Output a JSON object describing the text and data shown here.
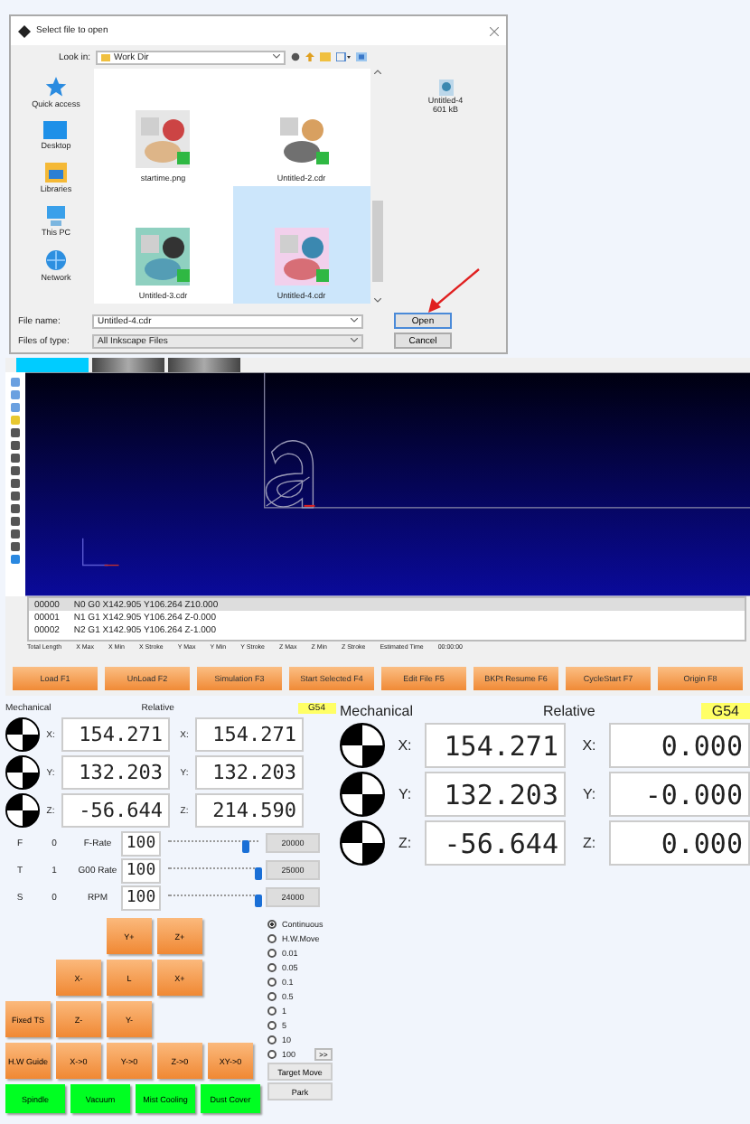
{
  "file_dialog": {
    "title": "Select file to open",
    "look_in_label": "Look in:",
    "look_in": "Work Dir",
    "places": [
      {
        "label": "Quick access",
        "kind": "star"
      },
      {
        "label": "Desktop",
        "kind": "desktop"
      },
      {
        "label": "Libraries",
        "kind": "library"
      },
      {
        "label": "This PC",
        "kind": "pc"
      },
      {
        "label": "Network",
        "kind": "network"
      }
    ],
    "files": [
      {
        "name": "startime.png",
        "selected": false
      },
      {
        "name": "Untitled-2.cdr",
        "selected": false
      },
      {
        "name": "Untitled-3.cdr",
        "selected": false
      },
      {
        "name": "Untitled-4.cdr",
        "selected": true
      }
    ],
    "preview": {
      "name": "Untitled-4",
      "size": "601 kB"
    },
    "file_name_label": "File name:",
    "file_name": "Untitled-4.cdr",
    "file_type_label": "Files of type:",
    "file_type": "All Inkscape Files",
    "buttons": [
      "Open",
      "Cancel"
    ]
  },
  "cnc": {
    "tabs": [
      {
        "selected": true
      },
      {
        "selected": false
      },
      {
        "selected": false
      }
    ],
    "gcode": [
      {
        "line": "00000",
        "code": "N0 G0 X142.905 Y106.264 Z10.000",
        "selected": true
      },
      {
        "line": "00001",
        "code": "N1 G1 X142.905 Y106.264 Z-0.000",
        "selected": false
      },
      {
        "line": "00002",
        "code": "N2 G1 X142.905 Y106.264 Z-1.000",
        "selected": false
      }
    ],
    "stats": [
      "Total Length",
      "X Max",
      "X Min",
      "X Stroke",
      "Y Max",
      "Y Min",
      "Y Stroke",
      "Z Max",
      "Z Min",
      "Z Stroke"
    ],
    "estimated_time_label": "Estimated Time",
    "estimated_time": "00:00:00",
    "buttons": [
      "Load F1",
      "UnLoad F2",
      "Simulation F3",
      "Start Selected F4",
      "Edit File F5",
      "BKPt Resume F6",
      "CycleStart F7",
      "Origin F8"
    ]
  },
  "control_panel": {
    "mechanical_label": "Mechanical",
    "relative_label": "Relative",
    "work_offset": "G54",
    "mechanical": [
      {
        "axis": "X:",
        "value": "154.271"
      },
      {
        "axis": "Y:",
        "value": "132.203"
      },
      {
        "axis": "Z:",
        "value": "-56.644"
      }
    ],
    "relative": [
      {
        "axis": "X:",
        "value": "154.271"
      },
      {
        "axis": "Y:",
        "value": "132.203"
      },
      {
        "axis": "Z:",
        "value": "214.590"
      }
    ],
    "overrides": [
      {
        "letter": "F",
        "value": "0",
        "label": "F-Rate",
        "percent": "100",
        "level": 0.85,
        "max": "20000"
      },
      {
        "letter": "T",
        "value": "1",
        "label": "G00 Rate",
        "percent": "100",
        "level": 1,
        "max": "25000"
      },
      {
        "letter": "S",
        "value": "0",
        "label": "RPM",
        "percent": "100",
        "level": 1,
        "max": "24000"
      }
    ],
    "step_modes": [
      {
        "label": "Continuous",
        "selected": true
      },
      {
        "label": "H.W.Move",
        "selected": false
      },
      {
        "label": "0.01",
        "selected": false
      },
      {
        "label": "0.05",
        "selected": false
      },
      {
        "label": "0.1",
        "selected": false
      },
      {
        "label": "0.5",
        "selected": false
      },
      {
        "label": "1",
        "selected": false
      },
      {
        "label": "5",
        "selected": false
      },
      {
        "label": "10",
        "selected": false
      },
      {
        "label": "100",
        "selected": false
      }
    ],
    "more_button": ">>",
    "target_move": "Target Move",
    "park": "Park",
    "jog_buttons": [
      "Y+",
      "Z+",
      "X-",
      "L",
      "X+",
      "Fixed TS",
      "Z-",
      "Y-",
      "H.W Guide",
      "X->0",
      "Y->0",
      "Z->0",
      "XY->0"
    ],
    "toggles": [
      "Spindle",
      "Vacuum",
      "Mist Cooling",
      "Dust Cover"
    ]
  },
  "zoomed_panel": {
    "mechanical_label": "Mechanical",
    "relative_label": "Relative",
    "work_offset": "G54",
    "mechanical": [
      {
        "axis": "X:",
        "value": "154.271"
      },
      {
        "axis": "Y:",
        "value": "132.203"
      },
      {
        "axis": "Z:",
        "value": "-56.644"
      }
    ],
    "relative": [
      {
        "axis": "X:",
        "value": "0.000"
      },
      {
        "axis": "Y:",
        "value": "-0.000"
      },
      {
        "axis": "Z:",
        "value": "0.000"
      }
    ]
  }
}
